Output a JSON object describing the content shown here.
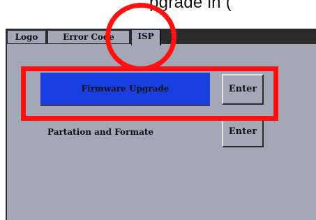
{
  "caption": {
    "text": "pgrade in ("
  },
  "tabs": [
    {
      "label": "Logo",
      "active": false
    },
    {
      "label": "Error Code",
      "active": false
    },
    {
      "label": "ISP",
      "active": true
    }
  ],
  "firmware": {
    "label": "Firmware Upgrade",
    "button_label": "Enter",
    "label_bg": "#1a3fe0"
  },
  "partition": {
    "label": "Partation and Formate",
    "button_label": "Enter"
  },
  "annotation_color": "#ff1111"
}
